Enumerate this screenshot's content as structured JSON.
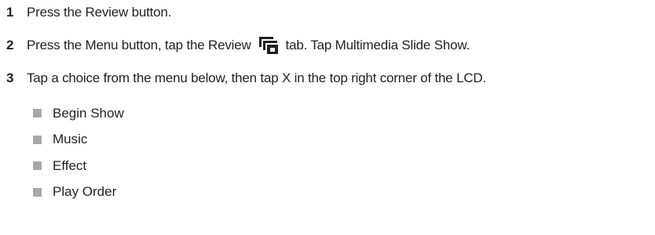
{
  "steps": [
    {
      "number": "1",
      "text": "Press the Review button."
    },
    {
      "number": "2",
      "text_before_icon": "Press the Menu button, tap the Review",
      "icon": "review-tab-icon",
      "text_after_icon": "tab. Tap Multimedia Slide Show."
    },
    {
      "number": "3",
      "text": "Tap a choice from the menu below, then tap X in the top right corner of the LCD."
    }
  ],
  "menu_choices": [
    "Begin Show",
    "Music",
    "Effect",
    "Play Order"
  ],
  "colors": {
    "text": "#231f20",
    "bullet": "#a8a8a8"
  }
}
